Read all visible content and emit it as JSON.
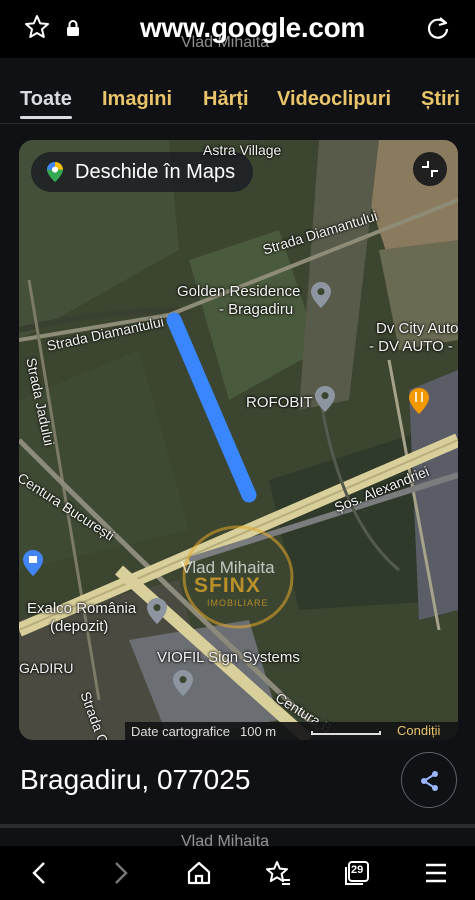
{
  "browser": {
    "url": "www.google.com",
    "icons": {
      "bookmark": "star-icon",
      "secure": "lock-icon",
      "reload": "reload-icon"
    }
  },
  "watermark": "Vlad Mihaita",
  "search_tabs": [
    {
      "label": "Toate",
      "active": true
    },
    {
      "label": "Imagini",
      "active": false
    },
    {
      "label": "Hărți",
      "active": false
    },
    {
      "label": "Videoclipuri",
      "active": false
    },
    {
      "label": "Știri",
      "active": false
    }
  ],
  "map": {
    "open_in_maps_label": "Deschide în Maps",
    "labels": {
      "astra_village": "Astra Village",
      "strada_diamantului_1": "Strada Diamantului",
      "strada_diamantului_2": "Strada Diamantului",
      "golden_residence_1": "Golden Residence",
      "golden_residence_2": "- Bragadiru",
      "dv_city_1": "Dv City Auto",
      "dv_city_2": "- DV AUTO -",
      "rofobit": "ROFOBIT",
      "strada_jadului": "Strada Jadului",
      "sos_alexandriei": "Șos. Alexandriei",
      "centura_bucuresti": "Centura București",
      "exalco_1": "Exalco România",
      "exalco_2": "(depozit)",
      "viofil": "VIOFIL Sign Systems",
      "gadiru": "GADIRU",
      "centura_2": "Centura B",
      "strada_o": "Strada O"
    },
    "attribution": {
      "data": "Date cartografice",
      "scale": "100 m",
      "terms": "Condiții"
    },
    "overlay": {
      "logo_text": "SFINX",
      "logo_sub": "IMOBILIARE"
    },
    "colors": {
      "highlight": "#3a86ff",
      "road": "#d8cf9a",
      "terms": "#e9c46a"
    }
  },
  "place": {
    "title": "Bragadiru, 077025"
  },
  "nav": {
    "icons": [
      "back-icon",
      "forward-icon",
      "home-icon",
      "bookmarks-icon",
      "tabs-icon",
      "menu-icon"
    ],
    "tab_count": "29"
  }
}
